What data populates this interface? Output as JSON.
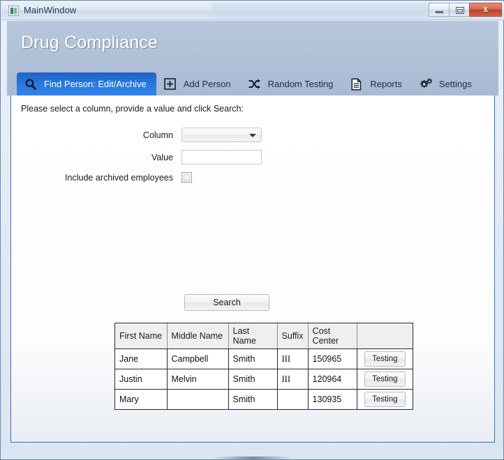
{
  "window": {
    "title": "MainWindow",
    "icon": "app-icon",
    "controls": {
      "minimize": "minimize-button",
      "restore": "restore-button",
      "close": "close-button",
      "close_glyph": "x"
    }
  },
  "header": {
    "app_title": "Drug Compliance"
  },
  "tabs": [
    {
      "label": "Find Person: Edit/Archive",
      "icon": "search-icon",
      "active": true
    },
    {
      "label": "Add Person",
      "icon": "plus-square-icon",
      "active": false
    },
    {
      "label": "Random Testing",
      "icon": "shuffle-icon",
      "active": false
    },
    {
      "label": "Reports",
      "icon": "document-icon",
      "active": false
    },
    {
      "label": "Settings",
      "icon": "gears-icon",
      "active": false
    }
  ],
  "form": {
    "instructions": "Please select a column, provide a value and click Search:",
    "column_label": "Column",
    "column_value": "",
    "column_placeholder": "",
    "value_label": "Value",
    "value_value": "",
    "value_placeholder": "",
    "include_archived_label": "Include archived employees",
    "include_archived_checked": false,
    "search_label": "Search"
  },
  "results": {
    "columns": [
      "First Name",
      "Middle Name",
      "Last Name",
      "Suffix",
      "Cost Center",
      ""
    ],
    "rows": [
      {
        "first_name": "Jane",
        "middle_name": "Campbell",
        "last_name": "Smith",
        "suffix": "III",
        "cost_center": "150965",
        "action_label": "Testing"
      },
      {
        "first_name": "Justin",
        "middle_name": "Melvin",
        "last_name": "Smith",
        "suffix": "III",
        "cost_center": "120964",
        "action_label": "Testing"
      },
      {
        "first_name": "Mary",
        "middle_name": "",
        "last_name": "Smith",
        "suffix": "",
        "cost_center": "130935",
        "action_label": "Testing"
      }
    ]
  },
  "colors": {
    "active_tab_blue": "#2a7ae0",
    "header_band": "#aebfd6",
    "panel_border": "#3c72b9",
    "close_button_red": "#c0472f"
  }
}
